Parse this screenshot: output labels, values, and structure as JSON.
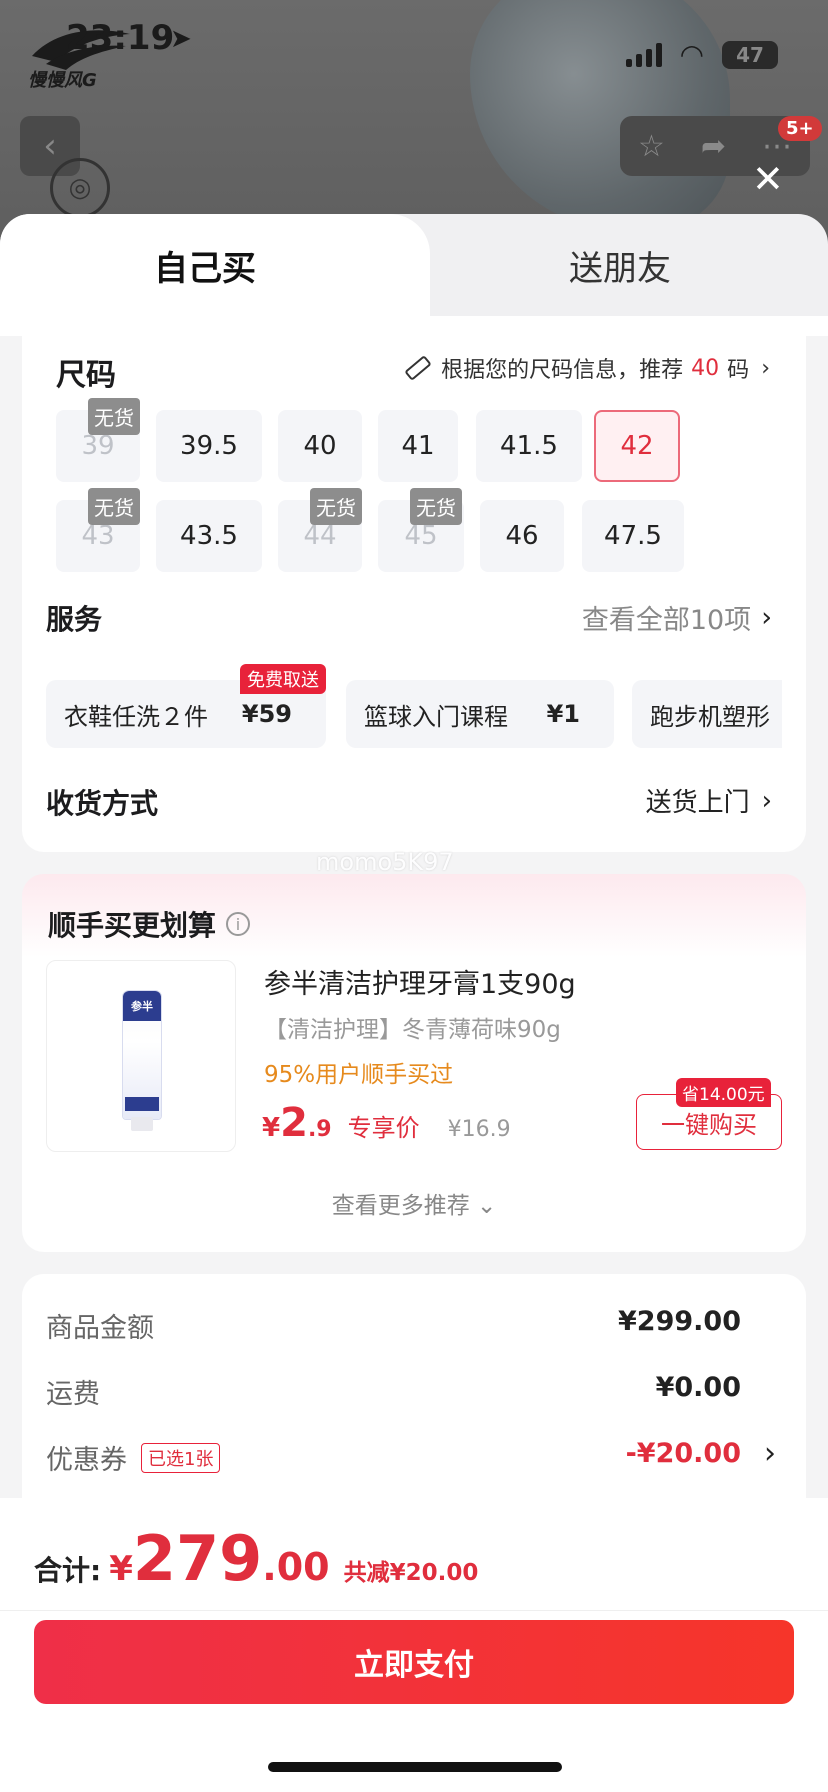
{
  "status_bar": {
    "time": "23:19",
    "battery": "47"
  },
  "brand": {
    "logo_text": "慢慢风G"
  },
  "header": {
    "badge": "5+"
  },
  "tabs": [
    {
      "label": "自己买"
    },
    {
      "label": "送朋友"
    }
  ],
  "size": {
    "title": "尺码",
    "recommend_prefix": "根据您的尺码信息，推荐",
    "recommend_size": "40",
    "recommend_suffix": "码",
    "out_label": "无货",
    "options": [
      "39",
      "39.5",
      "40",
      "41",
      "41.5",
      "42",
      "43",
      "43.5",
      "44",
      "45",
      "46",
      "47.5"
    ],
    "out_of_stock": [
      "39",
      "43",
      "44",
      "45"
    ],
    "selected": "42"
  },
  "service": {
    "title": "服务",
    "view_all": "查看全部10项",
    "items": [
      {
        "name": "衣鞋任洗２件",
        "price": "¥59",
        "tag": "免费取送"
      },
      {
        "name": "篮球入门课程",
        "price": "¥1"
      },
      {
        "name": "跑步机塑形",
        "price": ""
      }
    ]
  },
  "delivery": {
    "title": "收货方式",
    "value": "送货上门"
  },
  "watermark": "momo5K97",
  "addon": {
    "title": "顺手买更划算",
    "product": {
      "brand_on_tube": "参半",
      "name": "参半清洁护理牙膏1支90g",
      "desc": "【清洁护理】冬青薄荷味90g",
      "rate": "95%用户顺手买过",
      "price_symbol": "¥",
      "price_int": "2",
      "price_dec": ".9",
      "price_label": "专享价",
      "original_price": "¥16.9",
      "save_tag": "省14.00元",
      "buy_label": "一键购买"
    },
    "see_more": "查看更多推荐"
  },
  "summary": {
    "goods_label": "商品金额",
    "goods_value": "¥299.00",
    "shipping_label": "运费",
    "shipping_value": "¥0.00",
    "coupon_label": "优惠券",
    "coupon_tag": "已选1张",
    "coupon_value": "-¥20.00"
  },
  "checkout": {
    "total_label": "合计:",
    "symbol": "¥",
    "total_int": "279",
    "total_dec": ".00",
    "discount": "共减¥20.00",
    "pay_label": "立即支付"
  },
  "colors": {
    "accent": "#e02e3d",
    "pay_button": "#f23a3a",
    "rate": "#e68a1d"
  }
}
